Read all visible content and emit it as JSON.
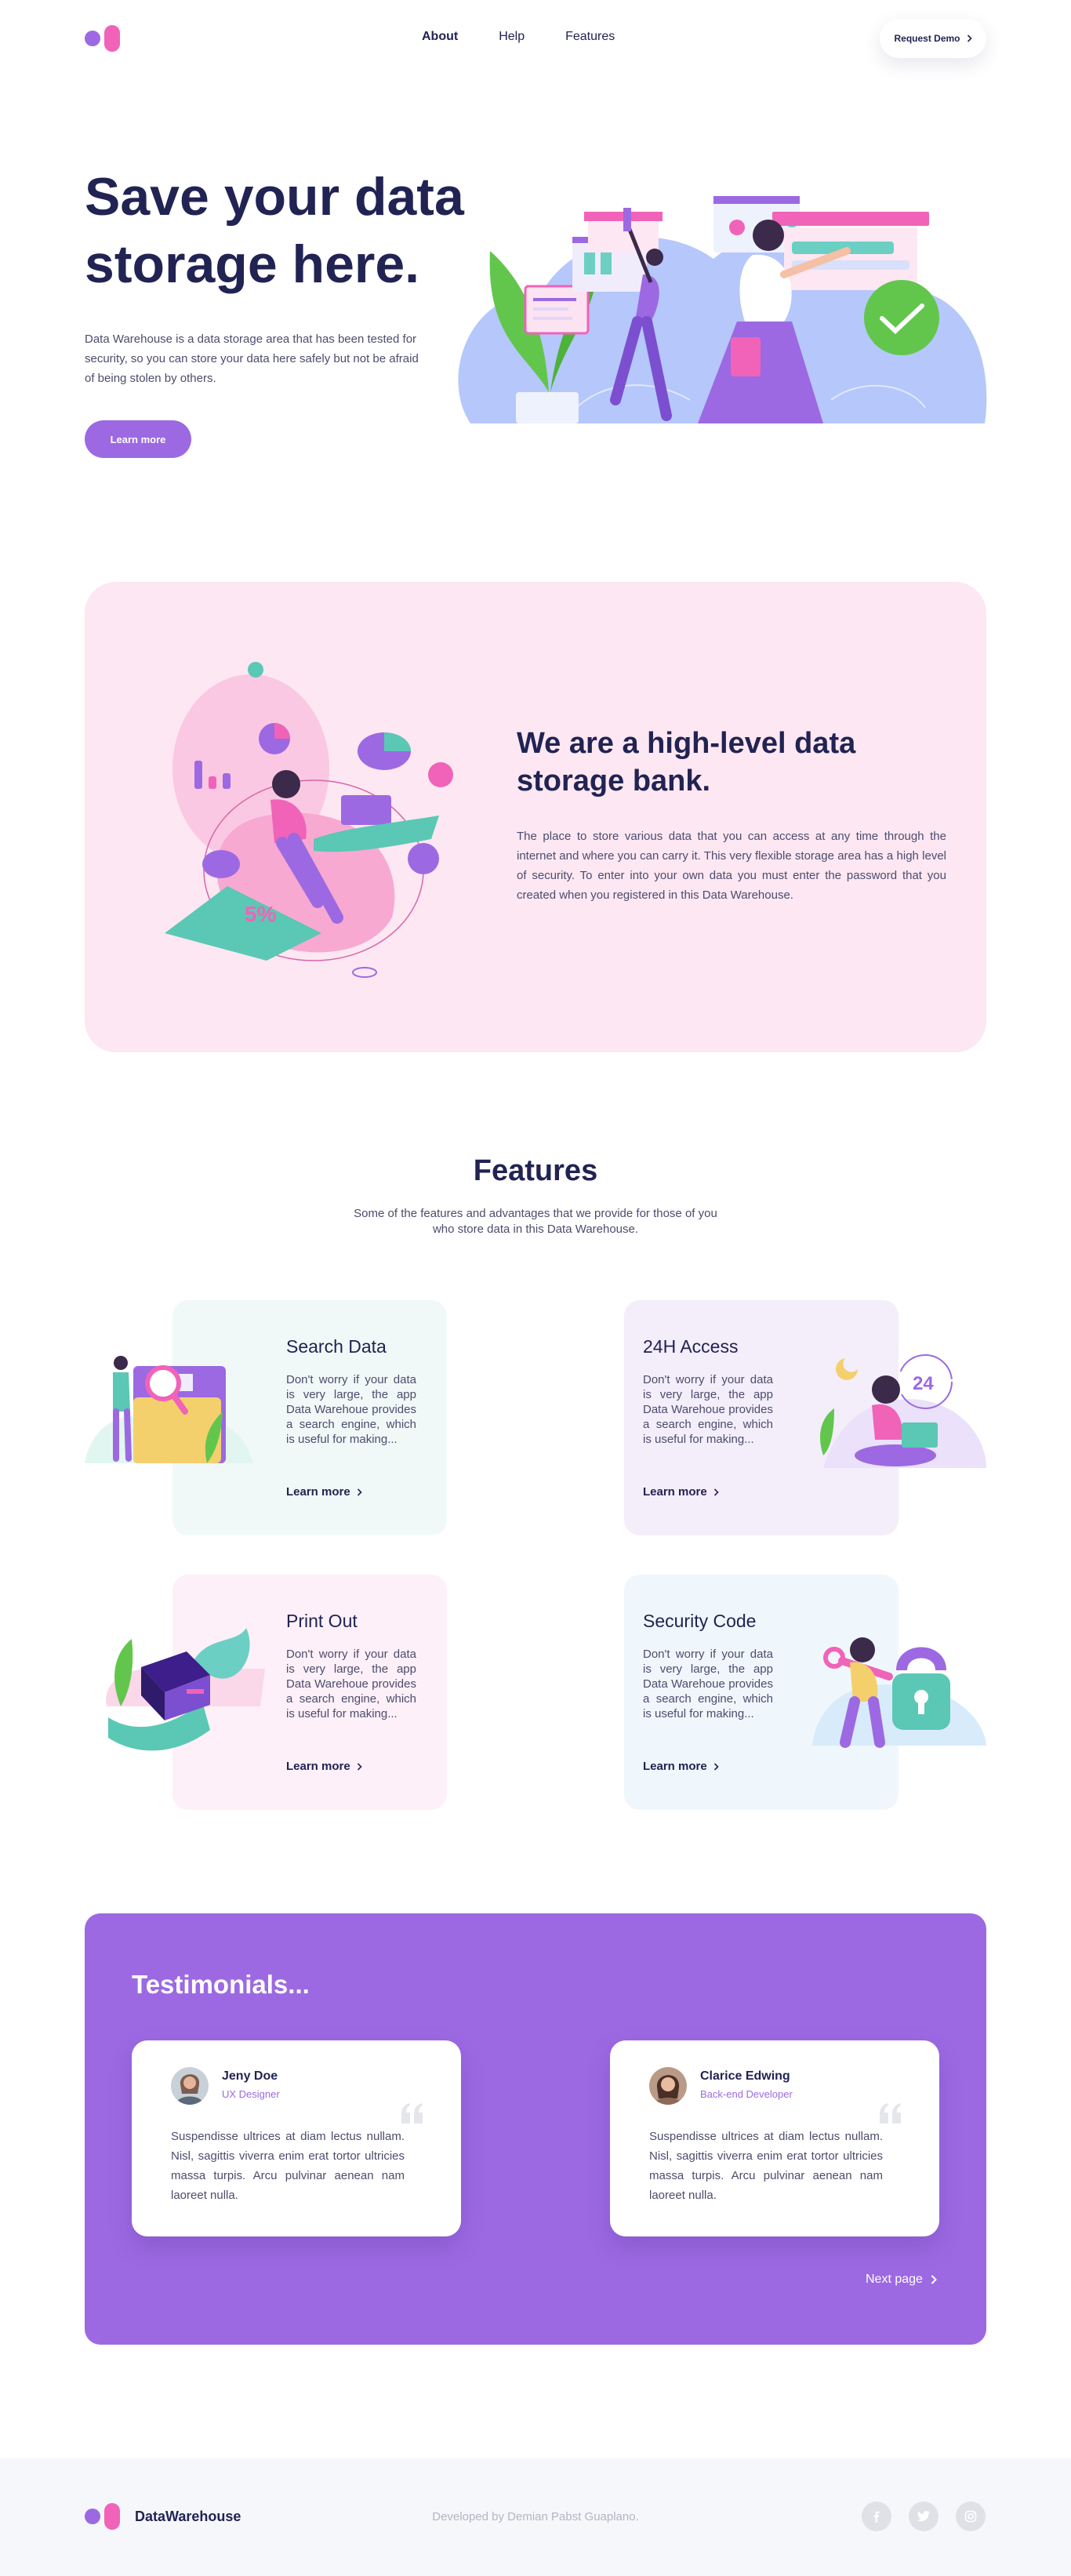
{
  "nav": {
    "brand_colors": {
      "dot": "#9c69e2",
      "pill": "#f063b8"
    },
    "links": [
      {
        "label": "About",
        "active": true
      },
      {
        "label": "Help",
        "active": false
      },
      {
        "label": "Features",
        "active": false
      }
    ],
    "demo_button": "Request Demo"
  },
  "hero": {
    "title_line1": "Save your data",
    "title_line2": "storage here.",
    "text": "Data Warehouse is a data storage area that has been tested for security, so you can store your data here safely but not be afraid of being stolen by others.",
    "button": "Learn more"
  },
  "bank": {
    "title_line1": "We are a high-level data",
    "title_line2": "storage bank.",
    "text": "The place to store various data that you can access at any time through the internet and where you can carry it. This very flexible storage area has a high level of security. To enter into your own data you must enter the password that you created when you registered in this Data Warehouse.",
    "illustration_label": "5%"
  },
  "features": {
    "title": "Features",
    "subtitle": "Some of the features and advantages that we provide for those of you who store data in this Data Warehouse.",
    "cards": [
      {
        "title": "Search Data",
        "text": "Don't worry if your data is very large, the app Data Warehoue provides a search engine, which is useful for making...",
        "link": "Learn more",
        "bg": "#f0f9f7"
      },
      {
        "title": "24H Access",
        "text": "Don't worry if your data is very large, the app Data Warehoue provides a search engine, which is useful for making...",
        "link": "Learn more",
        "bg": "#f3eefa",
        "illustration_label": "24"
      },
      {
        "title": "Print Out",
        "text": "Don't worry if your data is very large, the app Data Warehoue provides a search engine, which is useful for making...",
        "link": "Learn more",
        "bg": "#fdf0f8"
      },
      {
        "title": "Security Code",
        "text": "Don't worry if your data is very large, the app Data Warehoue provides a search engine, which is useful for making...",
        "link": "Learn more",
        "bg": "#f0f7fc"
      }
    ]
  },
  "testimonials": {
    "title": "Testimonials...",
    "items": [
      {
        "name": "Jeny Doe",
        "role": "UX Designer",
        "text": "Suspendisse ultrices at diam lectus nullam. Nisl, sagittis viverra enim erat tortor ultricies massa turpis. Arcu pulvinar aenean nam laoreet nulla."
      },
      {
        "name": "Clarice Edwing",
        "role": "Back-end Developer",
        "text": "Suspendisse ultrices at diam lectus nullam. Nisl, sagittis viverra enim erat tortor ultricies massa turpis. Arcu pulvinar aenean nam laoreet nulla."
      }
    ],
    "next_page": "Next page"
  },
  "footer": {
    "brand": "DataWarehouse",
    "credit": "Developed by Demian Pabst Guaplano.",
    "socials": [
      "facebook-icon",
      "twitter-icon",
      "instagram-icon"
    ]
  },
  "colors": {
    "primary": "#9c69e2",
    "pink": "#f063b8",
    "navy": "#212353",
    "teal": "#2cccc3"
  }
}
